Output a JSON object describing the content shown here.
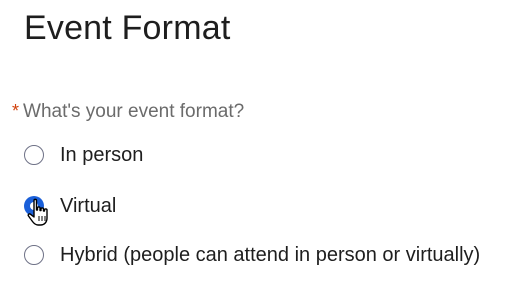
{
  "page": {
    "title": "Event Format"
  },
  "question": {
    "required_marker": "*",
    "label": "What's your event format?"
  },
  "options": [
    {
      "label": "In person",
      "checked": false
    },
    {
      "label": "Virtual",
      "checked": true
    },
    {
      "label": "Hybrid (people can attend in person or virtually)",
      "checked": false
    }
  ],
  "colors": {
    "accent": "#1a5fd9",
    "required": "#d1410c",
    "question_text": "#6b6b6b"
  },
  "icons": {
    "cursor": "hand-pointer-icon"
  }
}
